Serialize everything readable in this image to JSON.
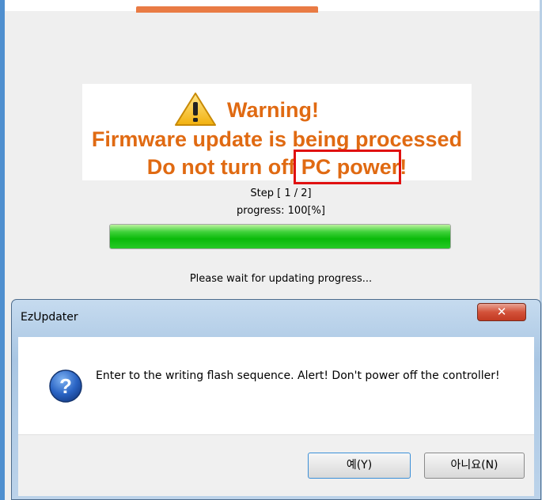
{
  "background_app": {
    "warning": {
      "title": "Warning!",
      "line2": "Firmware update is being processed",
      "line3": "Do not turn off PC power!",
      "icon": "warning-triangle-icon",
      "color": "#e06a12"
    },
    "step_text": "Step [ 1 / 2]",
    "progress_text": "progress: 100[%]",
    "progress_value": 100,
    "wait_text": "Please wait for updating progress..."
  },
  "dialog": {
    "title": "EzUpdater",
    "close_label": "✕",
    "icon": "question-icon",
    "message": "Enter to the writing flash sequence. Alert! Don't power off the controller!",
    "buttons": {
      "yes_label": "예(Y)",
      "no_label": "아니요(N)"
    },
    "highlight_color": "#e01010"
  }
}
